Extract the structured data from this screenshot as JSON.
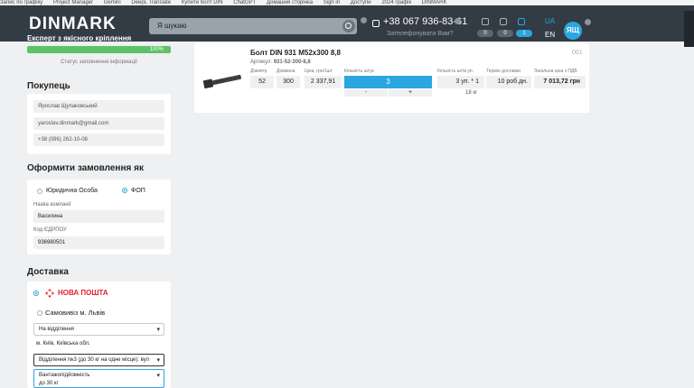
{
  "bookmarks": [
    "Запис по графіку",
    "Project Manager",
    "Gemini",
    "DeepL Translate",
    "Купити болт DIN",
    "ChatGPT",
    "Домашня сторінка",
    "Sign in",
    "Доступи",
    "2024 графік",
    "DINMARK"
  ],
  "header": {
    "logo": "DINMARK",
    "tagline": "Експерт з якісного кріплення",
    "search_placeholder": "Я шукаю",
    "phone": "+38 067 936-83-61",
    "callback": "Зателефонувати Вам?",
    "badges": [
      "0",
      "0",
      "1"
    ],
    "lang_active": "UA",
    "lang_other": "EN",
    "avatar": "ЯЩ"
  },
  "progress": {
    "value": "100%",
    "label": "Статус заповнення інформації"
  },
  "buyer": {
    "title": "Покупець",
    "name": "Ярослав Щупаковський",
    "email": "yaroslav.dinmark@gmail.com",
    "phone": "+38 (096) 262-10-08"
  },
  "order_as": {
    "title": "Оформити замовлення як",
    "legal": "Юридична Особа",
    "fop": "ФОП",
    "company_label": "Назва компанії",
    "company_value": "Василина",
    "edrpou_label": "Код ЄДРПОУ",
    "edrpou_value": "936980501"
  },
  "delivery": {
    "title": "Доставка",
    "carrier": "НОВА ПОШТА",
    "pickup": "Самовивіз м. Львів",
    "type_select": "На відділення",
    "city": "м. Київ, Київська обл.",
    "branch_select": "Відділення №3 (до 30 кг на одне місце): вул",
    "capacity_label": "Вантажопідйомність",
    "capacity_value": "до 30 кг"
  },
  "product": {
    "title": "Болт DIN 931 M52x300 8,8",
    "article_label": "Артикул:",
    "article": "931-52-300-8,8",
    "number": "001",
    "headers": {
      "diameter": "Діаметр",
      "length": "Довжина",
      "price": "Ціна, грн/1шт",
      "qty": "Кількість штук",
      "qty_pack": "Кількість шт/в уп.",
      "delivery": "Термін доставки",
      "total": "Загальна ціна з ПДВ"
    },
    "diameter": "52",
    "length": "300",
    "price": "2 337,91",
    "qty": "3",
    "minus": "-",
    "plus": "+",
    "pack": "3 уп. * 1",
    "weight": "18 кг",
    "delivery_time": "10 роб.дн.",
    "total": "7 013,72 грн"
  }
}
